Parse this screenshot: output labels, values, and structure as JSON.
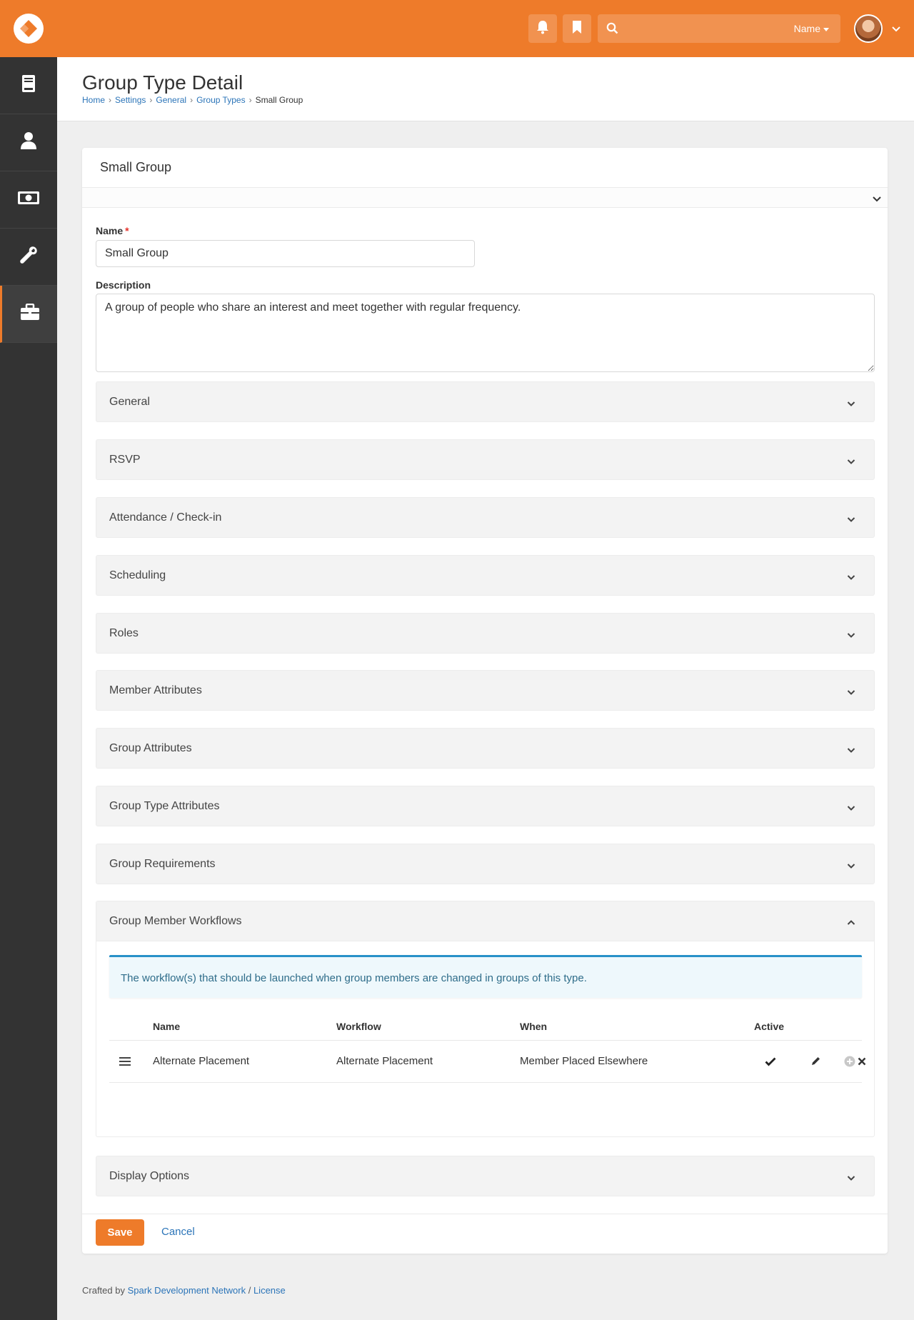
{
  "topbar": {
    "search_placeholder": "",
    "search_scope": "Name",
    "icons": [
      "logo-icon",
      "bell-icon",
      "bookmark-icon",
      "search-icon"
    ]
  },
  "sidebar": {
    "items": [
      {
        "name": "content",
        "icon": "book-icon"
      },
      {
        "name": "people",
        "icon": "person-icon"
      },
      {
        "name": "finance",
        "icon": "money-icon"
      },
      {
        "name": "admin-tools",
        "icon": "wrench-icon"
      },
      {
        "name": "settings",
        "icon": "briefcase-icon",
        "active": true
      }
    ]
  },
  "header": {
    "title": "Group Type Detail",
    "breadcrumb": [
      "Home",
      "Settings",
      "General",
      "Group Types",
      "Small Group"
    ]
  },
  "card": {
    "title": "Small Group"
  },
  "form": {
    "name_label": "Name",
    "name_value": "Small Group",
    "description_label": "Description",
    "description_value": "A group of people who share an interest and meet together with regular frequency."
  },
  "panels": [
    "General",
    "RSVP",
    "Attendance / Check-in",
    "Scheduling",
    "Roles",
    "Member Attributes",
    "Group Attributes",
    "Group Type Attributes",
    "Group Requirements"
  ],
  "workflows_panel": {
    "title": "Group Member Workflows",
    "info": "The workflow(s) that should be launched when group members are changed in groups of this type.",
    "columns": [
      "Name",
      "Workflow",
      "When",
      "Active"
    ],
    "rows": [
      {
        "name": "Alternate Placement",
        "workflow": "Alternate Placement",
        "when": "Member Placed Elsewhere",
        "active": true
      }
    ]
  },
  "display_panel": {
    "title": "Display Options"
  },
  "actions": {
    "save_label": "Save",
    "cancel_label": "Cancel"
  },
  "footer": {
    "prefix": "Crafted by",
    "org": "Spark Development Network",
    "sep": "/",
    "license": "License"
  },
  "colors": {
    "brand": "#ee7b2a",
    "sidebar": "#333333",
    "link": "#2b74b8",
    "info_border": "#2891c8"
  }
}
